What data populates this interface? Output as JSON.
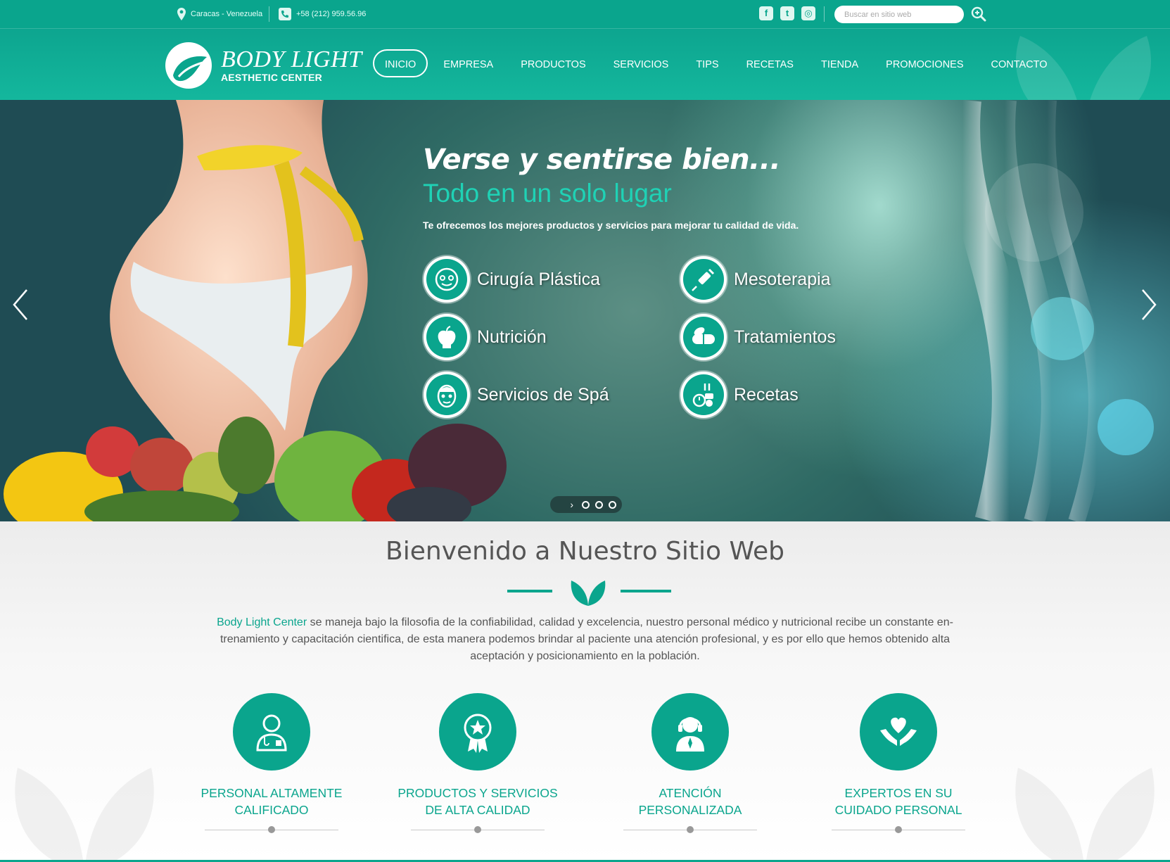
{
  "topbar": {
    "location": "Caracas - Venezuela",
    "phone": "+58 (212) 959.56.96",
    "social": [
      {
        "name": "facebook",
        "glyph": "f"
      },
      {
        "name": "twitter",
        "glyph": "t"
      },
      {
        "name": "instagram",
        "glyph": "◎"
      }
    ],
    "search_placeholder": "Buscar en sitio web"
  },
  "header": {
    "brand": "BODY LIGHT",
    "subtitle": "AESTHETIC CENTER",
    "nav": [
      {
        "label": "INICIO",
        "active": true
      },
      {
        "label": "EMPRESA"
      },
      {
        "label": "PRODUCTOS"
      },
      {
        "label": "SERVICIOS"
      },
      {
        "label": "TIPS"
      },
      {
        "label": "RECETAS"
      },
      {
        "label": "TIENDA"
      },
      {
        "label": "PROMOCIONES"
      },
      {
        "label": "CONTACTO"
      }
    ]
  },
  "hero": {
    "title": "Verse y sentirse bien...",
    "subtitle": "Todo en un solo lugar",
    "description": "Te ofrecemos los mejores productos y servicios para mejorar tu calidad de vida.",
    "services": [
      {
        "label": "Cirugía Plástica",
        "icon": "face-icon"
      },
      {
        "label": "Mesoterapia",
        "icon": "syringe-icon"
      },
      {
        "label": "Nutrición",
        "icon": "apple-icon"
      },
      {
        "label": "Tratamientos",
        "icon": "pill-icon"
      },
      {
        "label": "Servicios de Spá",
        "icon": "spa-mask-icon"
      },
      {
        "label": "Recetas",
        "icon": "recipe-icon"
      }
    ],
    "slides": 3
  },
  "welcome": {
    "title": "Bienvenido a Nuestro Sitio Web",
    "highlight": "Body Light Center",
    "text": " se maneja bajo la filosofia de la confiabilidad, calidad y excelencia, nuestro personal médico y nutricional recibe un constante en-trenamiento y capacitación cientifica, de esta manera podemos brindar al paciente una atención profesional, y es por ello que hemos obtenido alta aceptación y posicionamiento en la población.",
    "features": [
      {
        "line1": "PERSONAL ALTAMENTE",
        "line2": "CALIFICADO",
        "icon": "doctor-icon"
      },
      {
        "line1": "PRODUCTOS Y SERVICIOS",
        "line2": "DE ALTA CALIDAD",
        "icon": "award-icon"
      },
      {
        "line1": "ATENCIÓN",
        "line2": "PERSONALIZADA",
        "icon": "support-agent-icon"
      },
      {
        "line1": "EXPERTOS EN SU",
        "line2": "CUIDADO PERSONAL",
        "icon": "heart-hands-icon"
      }
    ]
  },
  "colors": {
    "accent": "#0aa58d",
    "accent_light": "#1fd2b5"
  }
}
